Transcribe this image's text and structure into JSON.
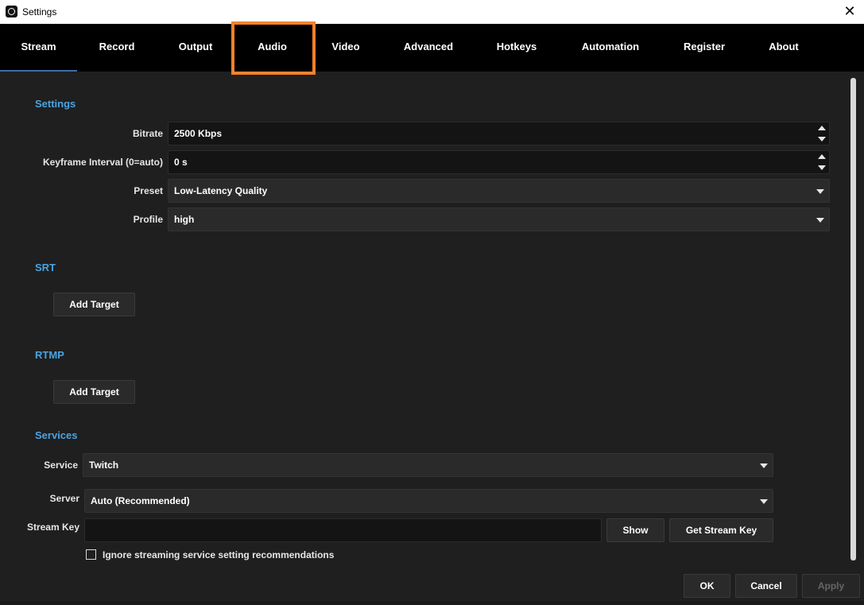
{
  "window": {
    "title": "Settings",
    "close_glyph": "✕"
  },
  "tabs": [
    {
      "label": "Stream"
    },
    {
      "label": "Record"
    },
    {
      "label": "Output"
    },
    {
      "label": "Audio"
    },
    {
      "label": "Video"
    },
    {
      "label": "Advanced"
    },
    {
      "label": "Hotkeys"
    },
    {
      "label": "Automation"
    },
    {
      "label": "Register"
    },
    {
      "label": "About"
    }
  ],
  "active_tab": "Stream",
  "highlighted_tab": "Audio",
  "settings": {
    "title": "Settings",
    "bitrate": {
      "label": "Bitrate",
      "value": "2500 Kbps"
    },
    "keyframe": {
      "label": "Keyframe Interval (0=auto)",
      "value": "0 s"
    },
    "preset": {
      "label": "Preset",
      "value": "Low-Latency Quality"
    },
    "profile": {
      "label": "Profile",
      "value": "high"
    }
  },
  "srt": {
    "title": "SRT",
    "add_target": "Add Target"
  },
  "rtmp": {
    "title": "RTMP",
    "add_target": "Add Target"
  },
  "services": {
    "title": "Services",
    "service": {
      "label": "Service",
      "value": "Twitch"
    },
    "server": {
      "label": "Server",
      "value": "Auto (Recommended)"
    },
    "stream_key": {
      "label": "Stream Key",
      "value": "",
      "show": "Show",
      "get": "Get Stream Key"
    },
    "ignore_label": "Ignore streaming service setting recommendations",
    "ignore_checked": false
  },
  "footer": {
    "ok": "OK",
    "cancel": "Cancel",
    "apply": "Apply"
  },
  "colors": {
    "accent": "#4aa3df",
    "highlight": "#f5812a",
    "background": "#1f1f1f"
  }
}
